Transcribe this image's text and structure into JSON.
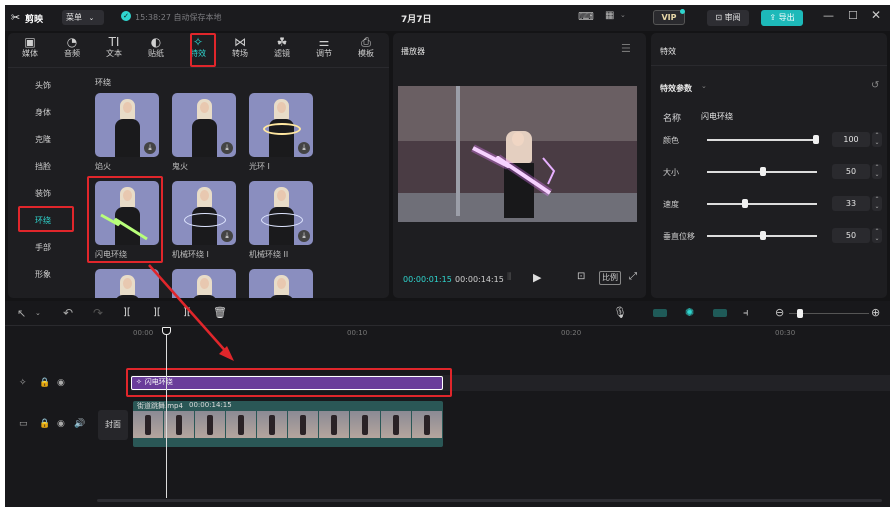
{
  "titlebar": {
    "app_name": "剪映",
    "menu_label": "菜单",
    "autosave_status": "15:38:27 自动保存本地",
    "project_title": "7月7日",
    "vip_label": "VIP",
    "review_label": "审阅",
    "export_label": "导出"
  },
  "toolbar": {
    "items": [
      {
        "label": "媒体",
        "icon": "▣"
      },
      {
        "label": "音频",
        "icon": "◔"
      },
      {
        "label": "文本",
        "icon": "TI"
      },
      {
        "label": "贴纸",
        "icon": "◐"
      },
      {
        "label": "特效",
        "icon": "✧"
      },
      {
        "label": "转场",
        "icon": "⋈"
      },
      {
        "label": "滤镜",
        "icon": "☘"
      },
      {
        "label": "调节",
        "icon": "⚌"
      },
      {
        "label": "模板",
        "icon": "⎙"
      }
    ]
  },
  "categories": [
    "头饰",
    "身体",
    "克隆",
    "挡脸",
    "装饰",
    "环绕",
    "手部",
    "形象"
  ],
  "effects_section": "环绕",
  "effects": [
    {
      "name": "焰火"
    },
    {
      "name": "鬼火"
    },
    {
      "name": "光环 I"
    },
    {
      "name": "闪电环绕"
    },
    {
      "name": "机械环绕 I"
    },
    {
      "name": "机械环绕 II"
    }
  ],
  "player": {
    "title": "播放器",
    "current_time": "00:00:01:15",
    "total_time": "00:00:14:15",
    "ratio_label": "比例"
  },
  "inspector": {
    "tab": "特效",
    "section": "特效参数",
    "name_label": "名称",
    "name_value": "闪电环绕",
    "params": [
      {
        "label": "颜色",
        "value": "100",
        "level": 1.0
      },
      {
        "label": "大小",
        "value": "50",
        "level": 0.5
      },
      {
        "label": "速度",
        "value": "33",
        "level": 0.33
      },
      {
        "label": "垂直位移",
        "value": "50",
        "level": 0.5
      }
    ]
  },
  "timeline": {
    "ruler": [
      "00:00",
      "00:10",
      "00:20",
      "00:30"
    ],
    "effect_clip": "闪电环绕",
    "video_clip_name": "街道跳舞.mp4",
    "video_clip_duration": "00:00:14:15",
    "cover_label": "封面"
  },
  "colors": {
    "accent": "#2fd6cf",
    "highlight_red": "#e0262b",
    "effect_clip": "#6a3d9a"
  }
}
